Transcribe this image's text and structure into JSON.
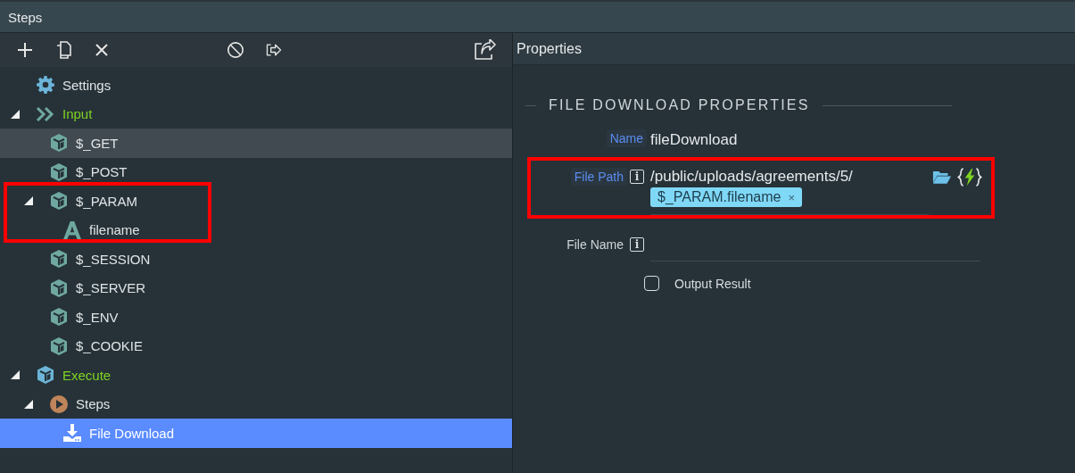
{
  "top_bar": {
    "title": "Steps"
  },
  "steps_panel": {
    "tree": [
      {
        "label": "Settings",
        "kind": "gear",
        "section": false,
        "selected": false,
        "hovered": false,
        "highlighted": false
      },
      {
        "label": "Input",
        "kind": "chevrons",
        "section": true,
        "selected": false,
        "hovered": false,
        "highlighted": false,
        "expanded": true,
        "children": [
          {
            "label": "$_GET",
            "kind": "cube",
            "section": false,
            "selected": false,
            "hovered": true,
            "highlighted": false
          },
          {
            "label": "$_POST",
            "kind": "cube",
            "section": false,
            "selected": false,
            "hovered": false,
            "highlighted": false
          },
          {
            "label": "$_PARAM",
            "kind": "cube",
            "section": false,
            "selected": false,
            "hovered": false,
            "highlighted": true,
            "expanded": true,
            "children": [
              {
                "label": "filename",
                "kind": "letter",
                "section": false,
                "selected": false,
                "hovered": false,
                "highlighted": false
              }
            ]
          },
          {
            "label": "$_SESSION",
            "kind": "cube",
            "section": false,
            "selected": false,
            "hovered": false,
            "highlighted": false
          },
          {
            "label": "$_SERVER",
            "kind": "cube",
            "section": false,
            "selected": false,
            "hovered": false,
            "highlighted": false
          },
          {
            "label": "$_ENV",
            "kind": "cube",
            "section": false,
            "selected": false,
            "hovered": false,
            "highlighted": false
          },
          {
            "label": "$_COOKIE",
            "kind": "cube",
            "section": false,
            "selected": false,
            "hovered": false,
            "highlighted": false
          }
        ]
      },
      {
        "label": "Execute",
        "kind": "execute",
        "section": true,
        "selected": false,
        "hovered": false,
        "highlighted": false,
        "expanded": true,
        "children": [
          {
            "label": "Steps",
            "kind": "play",
            "section": false,
            "selected": false,
            "hovered": false,
            "highlighted": false,
            "expanded": true,
            "children": [
              {
                "label": "File Download",
                "kind": "download",
                "section": false,
                "selected": true,
                "hovered": false,
                "highlighted": false
              }
            ]
          }
        ]
      }
    ]
  },
  "properties_panel": {
    "title": "Properties",
    "section_title": "FILE DOWNLOAD PROPERTIES",
    "fields": [
      {
        "kind": "text",
        "label": "Name",
        "required": true,
        "highlighted": false,
        "value": "fileDownload"
      },
      {
        "kind": "path",
        "label": "File Path",
        "required": true,
        "info": "i",
        "highlighted": true,
        "value": "/public/uploads/agreements/5/",
        "tags": [
          {
            "label": "$_PARAM.filename",
            "remove": "×"
          }
        ]
      },
      {
        "kind": "text",
        "label": "File Name",
        "required": false,
        "info": "i",
        "highlighted": false
      },
      {
        "kind": "checkbox",
        "label": "Output Result",
        "checked": false
      }
    ]
  }
}
